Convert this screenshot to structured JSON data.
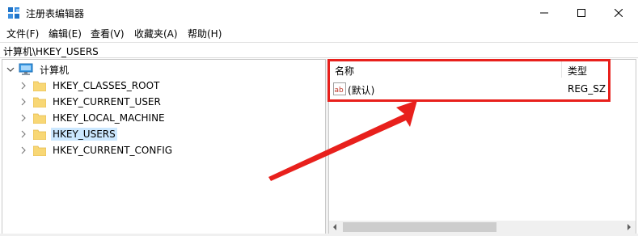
{
  "window": {
    "title": "注册表编辑器",
    "controls": {
      "minimize": "minimize",
      "maximize": "maximize",
      "close": "close"
    }
  },
  "menu": [
    {
      "label": "文件(F)"
    },
    {
      "label": "编辑(E)"
    },
    {
      "label": "查看(V)"
    },
    {
      "label": "收藏夹(A)"
    },
    {
      "label": "帮助(H)"
    }
  ],
  "address": "计算机\\HKEY_USERS",
  "tree": {
    "root": "计算机",
    "items": [
      {
        "label": "HKEY_CLASSES_ROOT",
        "selected": false
      },
      {
        "label": "HKEY_CURRENT_USER",
        "selected": false
      },
      {
        "label": "HKEY_LOCAL_MACHINE",
        "selected": false
      },
      {
        "label": "HKEY_USERS",
        "selected": true
      },
      {
        "label": "HKEY_CURRENT_CONFIG",
        "selected": false
      }
    ]
  },
  "list": {
    "columns": {
      "name": "名称",
      "type": "类型"
    },
    "rows": [
      {
        "name": "(默认)",
        "type": "REG_SZ",
        "icon": "string-value-icon"
      }
    ]
  },
  "annotation": {
    "color": "#e8201c"
  },
  "colors": {
    "selection": "#cce8ff",
    "folder": "#f8d775",
    "folder_dark": "#e3b84a"
  }
}
